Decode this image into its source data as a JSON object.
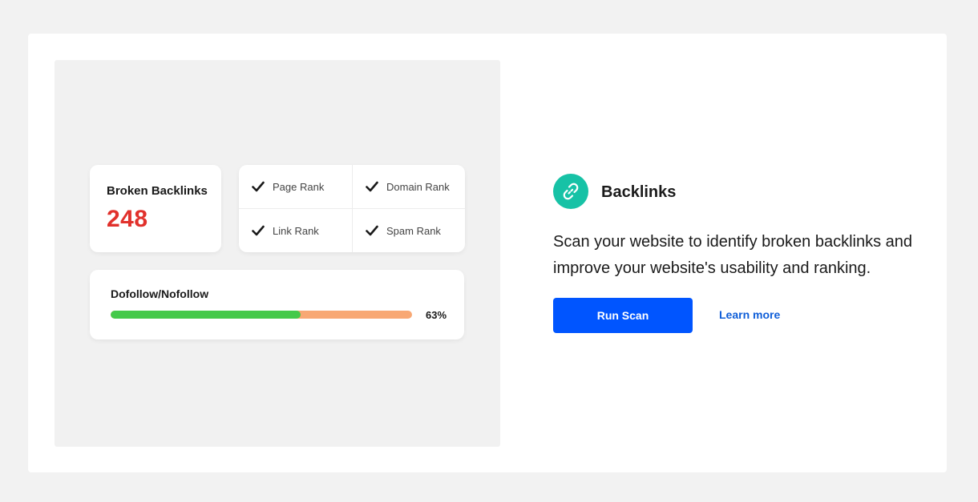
{
  "preview": {
    "broken": {
      "title": "Broken Backlinks",
      "count": "248"
    },
    "ranks": [
      "Page Rank",
      "Domain Rank",
      "Link Rank",
      "Spam Rank"
    ],
    "follow": {
      "title": "Dofollow/Nofollow",
      "percent_label": "63%",
      "dofollow_fraction": 0.63
    }
  },
  "feature": {
    "icon": "link-icon",
    "title": "Backlinks",
    "description": "Scan your website to identify broken backlinks and improve your website's usability and ranking.",
    "primary_button": "Run Scan",
    "secondary_link": "Learn more"
  },
  "colors": {
    "accent": "#0055ff",
    "icon_bg": "#17c2a6",
    "broken_count": "#e1312c",
    "dofollow": "#45c94a",
    "nofollow": "#f8a874"
  }
}
